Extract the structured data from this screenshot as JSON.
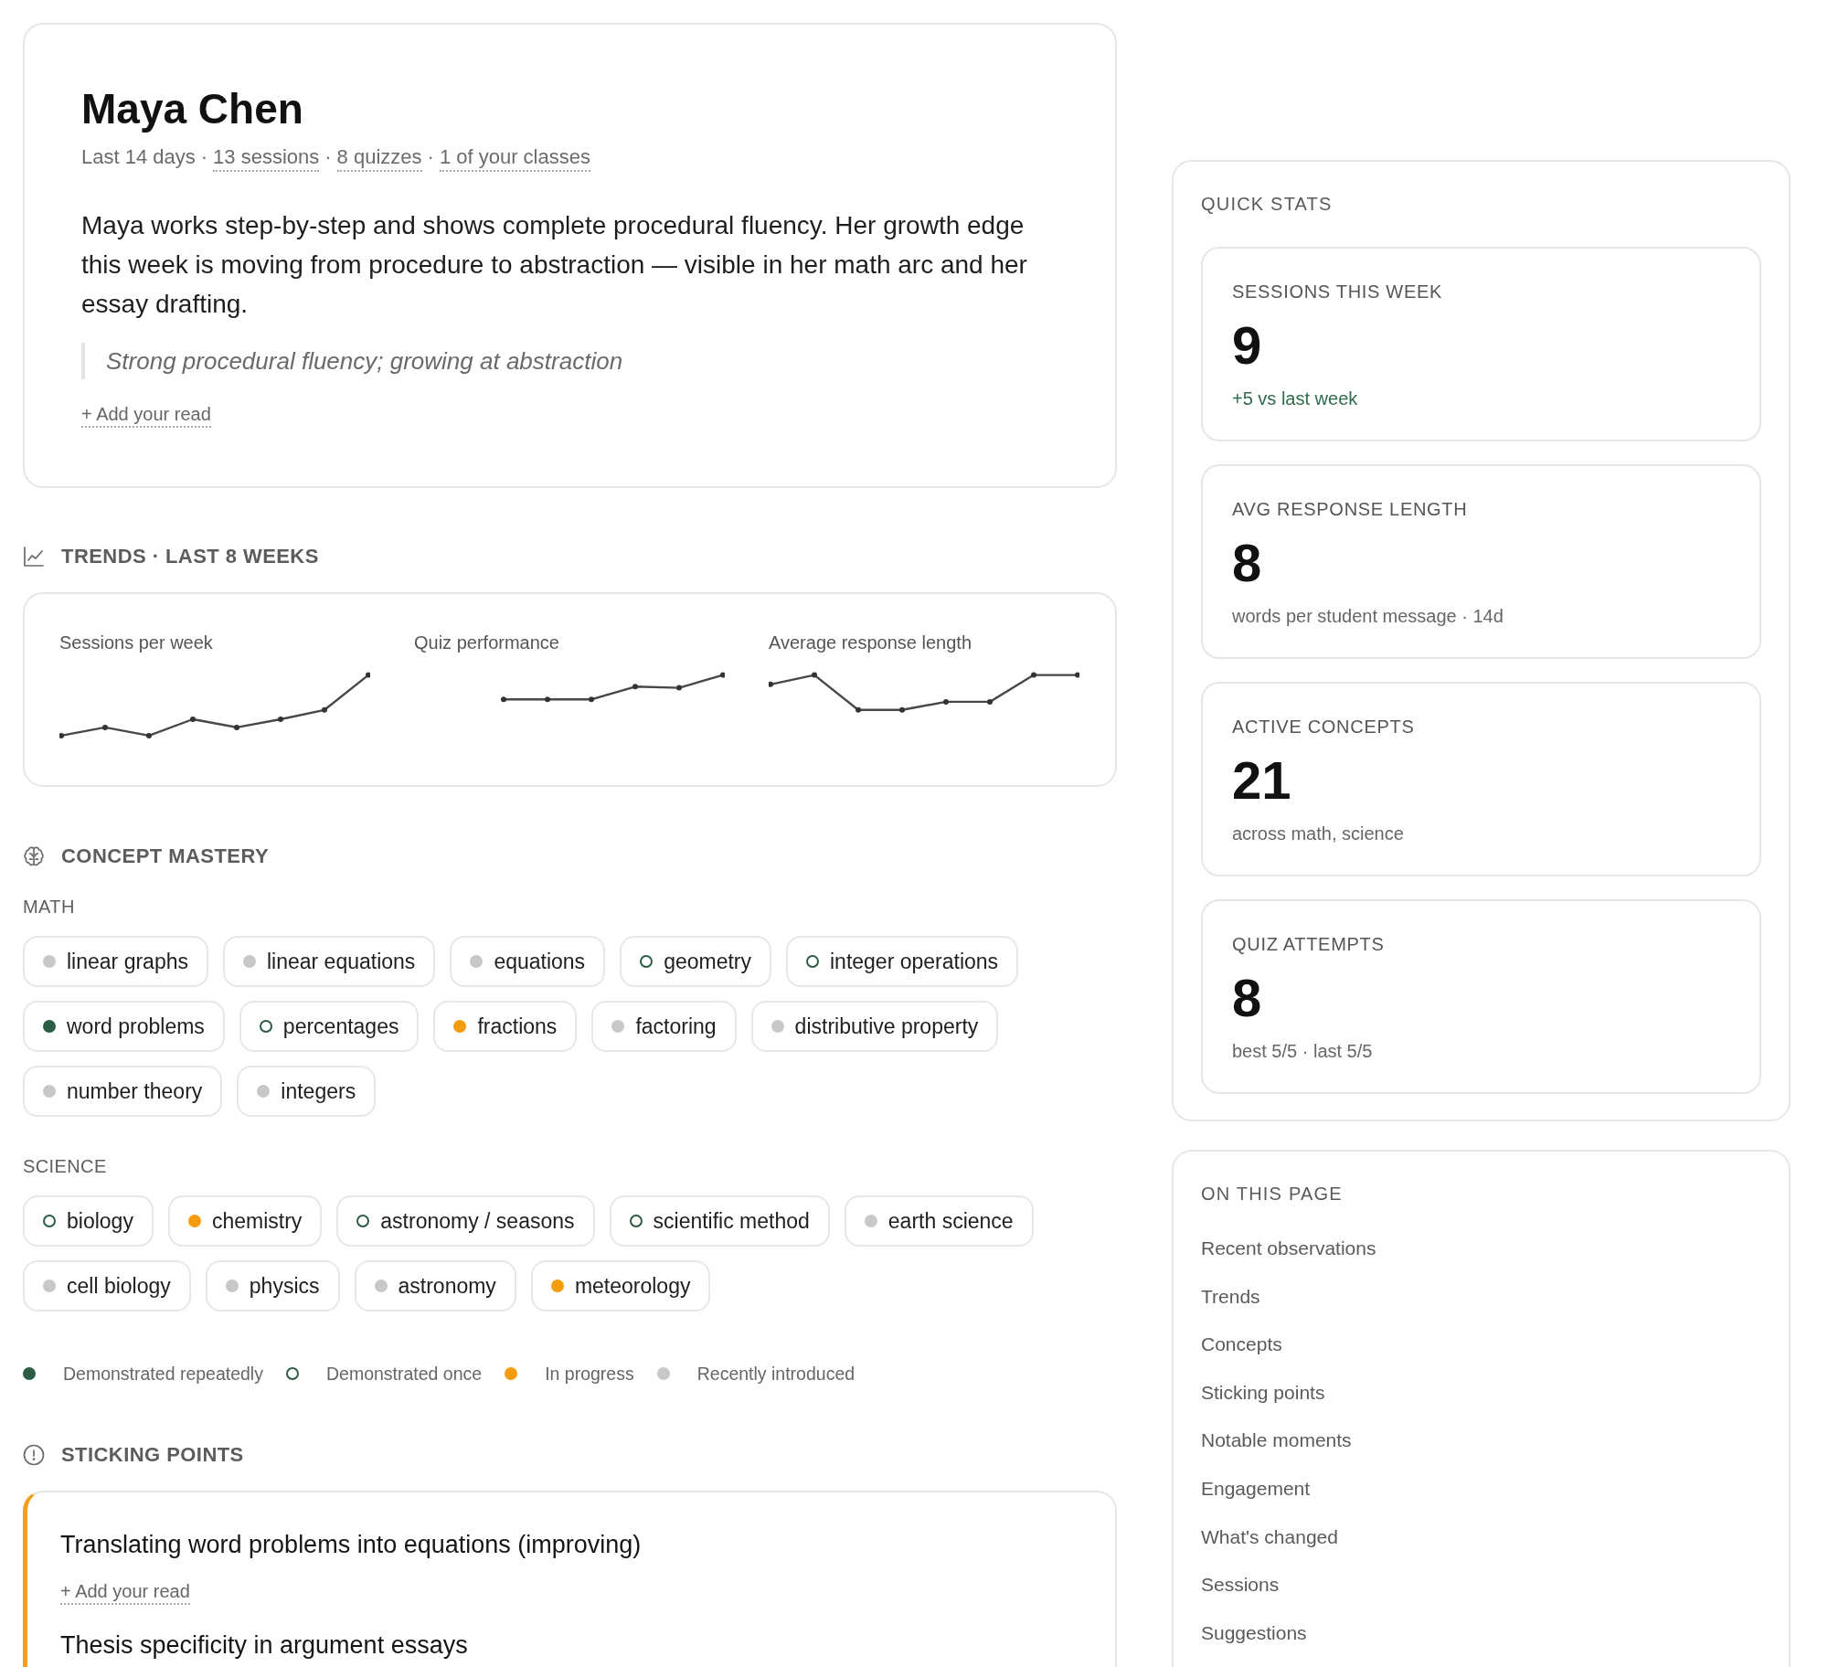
{
  "profile": {
    "name": "Maya Chen",
    "meta": {
      "separator": "·",
      "items": [
        {
          "text": "Last 14 days",
          "link": false
        },
        {
          "text": "13 sessions",
          "link": true
        },
        {
          "text": "8 quizzes",
          "link": true
        },
        {
          "text": "1 of your classes",
          "link": true
        }
      ]
    },
    "summary": "Maya works step-by-step and shows complete procedural fluency. Her growth edge this week is moving from procedure to abstraction — visible in her math arc and her essay drafting.",
    "quote": "Strong procedural fluency; growing at abstraction",
    "add_read": "+ Add your read"
  },
  "trends": {
    "heading": "TRENDS · LAST 8 WEEKS",
    "charts": [
      {
        "label": "Sessions per week"
      },
      {
        "label": "Quiz performance"
      },
      {
        "label": "Average response length"
      }
    ]
  },
  "concepts": {
    "heading": "CONCEPT MASTERY",
    "groups": [
      {
        "label": "MATH",
        "items": [
          {
            "name": "linear graphs",
            "kind": "introduced"
          },
          {
            "name": "linear equations",
            "kind": "introduced"
          },
          {
            "name": "equations",
            "kind": "introduced"
          },
          {
            "name": "geometry",
            "kind": "once"
          },
          {
            "name": "integer operations",
            "kind": "once"
          },
          {
            "name": "word problems",
            "kind": "repeated"
          },
          {
            "name": "percentages",
            "kind": "once"
          },
          {
            "name": "fractions",
            "kind": "progress"
          },
          {
            "name": "factoring",
            "kind": "introduced"
          },
          {
            "name": "distributive property",
            "kind": "introduced"
          },
          {
            "name": "number theory",
            "kind": "introduced"
          },
          {
            "name": "integers",
            "kind": "introduced"
          }
        ]
      },
      {
        "label": "SCIENCE",
        "items": [
          {
            "name": "biology",
            "kind": "once"
          },
          {
            "name": "chemistry",
            "kind": "progress"
          },
          {
            "name": "astronomy / seasons",
            "kind": "once"
          },
          {
            "name": "scientific method",
            "kind": "once"
          },
          {
            "name": "earth science",
            "kind": "introduced"
          },
          {
            "name": "cell biology",
            "kind": "introduced"
          },
          {
            "name": "physics",
            "kind": "introduced"
          },
          {
            "name": "astronomy",
            "kind": "introduced"
          },
          {
            "name": "meteorology",
            "kind": "progress"
          }
        ]
      }
    ],
    "legend": [
      {
        "kind": "repeated",
        "label": "Demonstrated repeatedly"
      },
      {
        "kind": "once",
        "label": "Demonstrated once"
      },
      {
        "kind": "progress",
        "label": "In progress"
      },
      {
        "kind": "introduced",
        "label": "Recently introduced"
      }
    ]
  },
  "sticking_points": {
    "heading": "STICKING POINTS",
    "items": [
      {
        "title": "Translating word problems into equations (improving)",
        "add_read": "+ Add your read"
      },
      {
        "title": "Thesis specificity in argument essays"
      }
    ]
  },
  "quick_stats": {
    "heading": "QUICK STATS",
    "cards": [
      {
        "label": "SESSIONS THIS WEEK",
        "value": "9",
        "note": "+5 vs last week",
        "color": "#2e6b4b"
      },
      {
        "label": "AVG RESPONSE LENGTH",
        "value": "8",
        "note": "words per student message · 14d",
        "color": "#666666"
      },
      {
        "label": "ACTIVE CONCEPTS",
        "value": "21",
        "note": "across math, science",
        "color": "#666666"
      },
      {
        "label": "QUIZ ATTEMPTS",
        "value": "8",
        "note": "best 5/5 · last 5/5",
        "color": "#666666"
      }
    ]
  },
  "on_this_page": {
    "heading": "ON THIS PAGE",
    "items": [
      "Recent observations",
      "Trends",
      "Concepts",
      "Sticking points",
      "Notable moments",
      "Engagement",
      "What's changed",
      "Sessions",
      "Suggestions"
    ]
  }
}
